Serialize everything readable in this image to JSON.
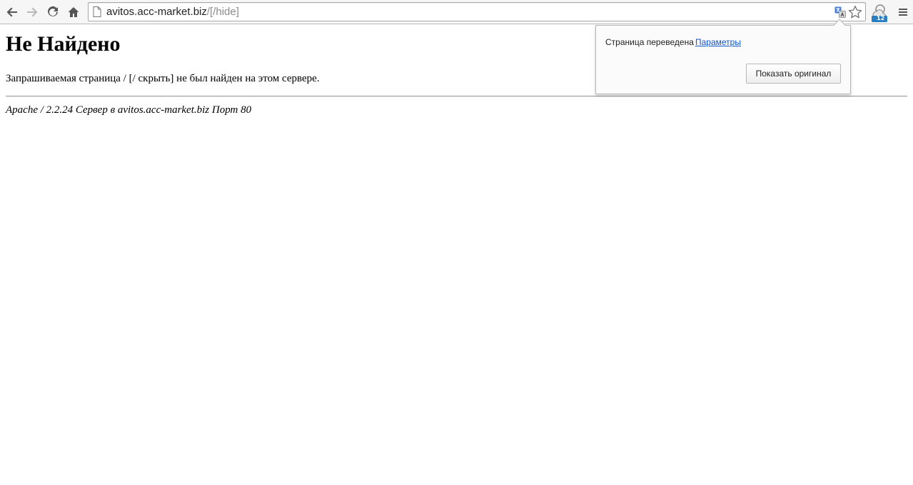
{
  "browser": {
    "url_host": "avitos.acc-market.biz",
    "url_path": "/[/hide]",
    "icons": {
      "back": "back-arrow-icon",
      "forward": "forward-arrow-icon",
      "reload": "reload-icon",
      "home": "home-icon",
      "page": "page-icon",
      "translate": "translate-icon",
      "star": "bookmark-star-icon",
      "extension": "weather-extension-icon",
      "menu": "menu-icon"
    },
    "extension_badge": "12"
  },
  "page": {
    "heading": "Не Найдено",
    "message": "Запрашиваемая страница / [/ скрыть] не был найден на этом сервере.",
    "address": "Apache / 2.2.24 Сервер в avitos.acc-market.biz Порт 80"
  },
  "translate_popup": {
    "message": "Страница переведена",
    "settings_link": "Параметры",
    "show_original_button": "Показать оригинал"
  },
  "colors": {
    "link": "#1155cc",
    "toolbar_bg": "#f6f6f6",
    "extension_accent": "#2a7fc1"
  }
}
